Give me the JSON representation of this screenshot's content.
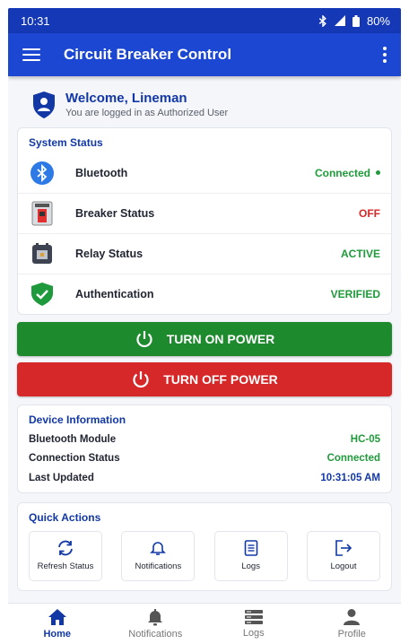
{
  "status_bar": {
    "time": "10:31",
    "battery": "80%"
  },
  "app_bar": {
    "title": "Circuit Breaker Control"
  },
  "welcome": {
    "name": "Welcome, Lineman",
    "subtitle": "You are logged in as Authorized User"
  },
  "system_status": {
    "heading": "System Status",
    "rows": [
      {
        "label": "Bluetooth",
        "value": "Connected",
        "color": "#1f9a3a",
        "icon": "bluetooth-icon"
      },
      {
        "label": "Breaker Status",
        "value": "OFF",
        "color": "#d62828",
        "icon": "breaker-icon"
      },
      {
        "label": "Relay Status",
        "value": "ACTIVE",
        "color": "#1f9a3a",
        "icon": "relay-icon"
      },
      {
        "label": "Authentication",
        "value": "VERIFIED",
        "color": "#1f9a3a",
        "icon": "shield-check-icon"
      }
    ]
  },
  "actions": {
    "turn_on": "TURN ON POWER",
    "turn_off": "TURN OFF POWER"
  },
  "device_info": {
    "heading": "Device Information",
    "rows": [
      {
        "label": "Bluetooth Module",
        "value": "HC-05",
        "color": "#1f9a3a"
      },
      {
        "label": "Connection Status",
        "value": "Connected",
        "color": "#1f9a3a"
      },
      {
        "label": "Last Updated",
        "value": "10:31:05 AM",
        "color": "#1238a6"
      }
    ]
  },
  "quick_actions": {
    "heading": "Quick Actions",
    "items": [
      {
        "label": "Refresh Status",
        "icon": "refresh-icon"
      },
      {
        "label": "Notifications",
        "icon": "bell-icon"
      },
      {
        "label": "Logs",
        "icon": "document-icon"
      },
      {
        "label": "Logout",
        "icon": "logout-icon"
      }
    ]
  },
  "bottom_nav": {
    "items": [
      {
        "label": "Home",
        "icon": "home-icon",
        "active": true
      },
      {
        "label": "Notifications",
        "icon": "bell-icon",
        "active": false
      },
      {
        "label": "Logs",
        "icon": "list-icon",
        "active": false
      },
      {
        "label": "Profile",
        "icon": "person-icon",
        "active": false
      }
    ]
  },
  "colors": {
    "primary": "#1c47d3",
    "success": "#1e8a2e",
    "danger": "#d62828"
  }
}
